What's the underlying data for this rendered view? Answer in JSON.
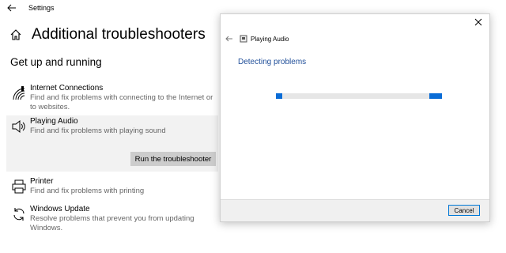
{
  "window": {
    "app_title": "Settings"
  },
  "page": {
    "title": "Additional troubleshooters",
    "section": "Get up and running"
  },
  "troubleshooters": [
    {
      "name": "Internet Connections",
      "desc": "Find and fix problems with connecting to the Internet or to websites."
    },
    {
      "name": "Playing Audio",
      "desc": "Find and fix problems with playing sound",
      "button": "Run the troubleshooter"
    },
    {
      "name": "Printer",
      "desc": "Find and fix problems with printing"
    },
    {
      "name": "Windows Update",
      "desc": "Resolve problems that prevent you from updating Windows."
    }
  ],
  "dialog": {
    "title": "Playing Audio",
    "status": "Detecting problems",
    "cancel_label": "Cancel"
  },
  "colors": {
    "accent": "#0a6cd6",
    "status_text": "#1f4e99",
    "selected_bg": "#f2f2f2"
  },
  "icons": {
    "back": "back-arrow-icon",
    "home": "home-icon",
    "internet": "wifi-icon",
    "audio": "speaker-icon",
    "printer": "printer-icon",
    "update": "refresh-icon",
    "close": "close-icon"
  }
}
